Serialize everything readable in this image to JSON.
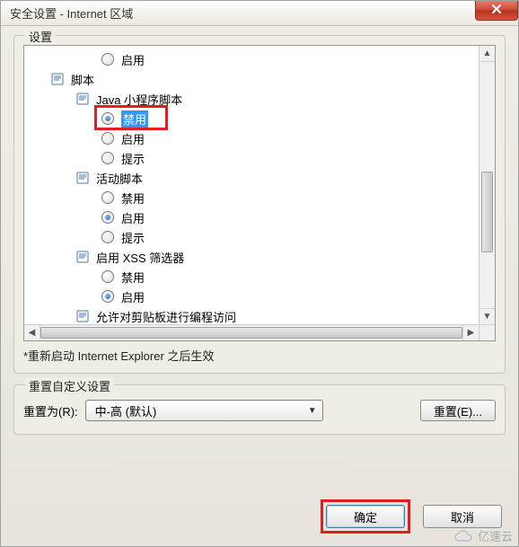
{
  "title": "安全设置 - Internet 区域",
  "settings_legend": "设置",
  "tree": {
    "top_enable": "启用",
    "scripts_header": "脚本",
    "java_applet": "Java 小程序脚本",
    "disable": "禁用",
    "enable": "启用",
    "prompt": "提示",
    "active_scripting": "活动脚本",
    "xss_filter": "启用 XSS 筛选器",
    "clipboard_access": "允许对剪贴板进行编程访问"
  },
  "note": "*重新启动 Internet Explorer 之后生效",
  "reset_legend": "重置自定义设置",
  "reset_label": "重置为(R):",
  "reset_combo": "中-高 (默认)",
  "reset_button": "重置(E)...",
  "ok": "确定",
  "cancel": "取消",
  "watermark": "亿速云"
}
